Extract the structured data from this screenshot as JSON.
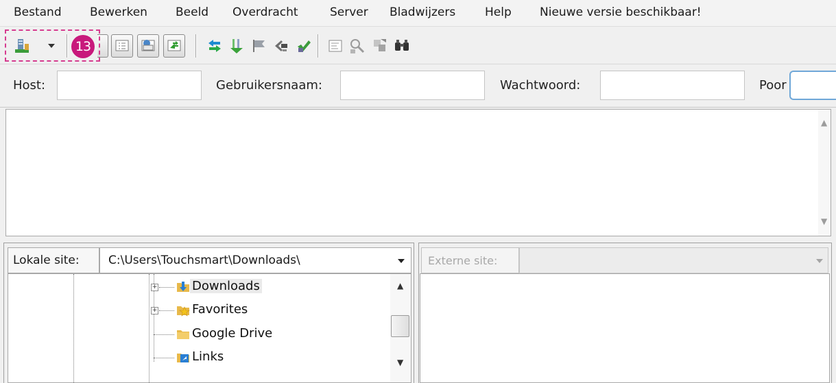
{
  "menu": [
    "Bestand",
    "Bewerken",
    "Beeld",
    "Overdracht",
    "Server",
    "Bladwijzers",
    "Help",
    "Nieuwe versie beschikbaar!"
  ],
  "annotation": {
    "badge_number": "13",
    "color": "#c8197c"
  },
  "toolbar": {
    "icons": [
      "site-manager-icon",
      "dropdown-arrow-icon",
      "toggle-message-log-icon",
      "toggle-local-tree-icon",
      "toggle-remote-tree-icon",
      "toggle-transfer-queue-icon",
      "refresh-icon",
      "process-queue-icon",
      "cancel-icon",
      "disconnect-icon",
      "reconnect-icon",
      "filter-icon",
      "compare-directories-icon",
      "sync-browsing-icon",
      "search-files-icon"
    ]
  },
  "quickconnect": {
    "host_label": "Host:",
    "user_label": "Gebruikersnaam:",
    "password_label": "Wachtwoord:",
    "port_label": "Poor",
    "host_value": "",
    "user_value": "",
    "password_value": ""
  },
  "local": {
    "label": "Lokale site:",
    "path": "C:\\Users\\Touchsmart\\Downloads\\",
    "tree": [
      {
        "label": "Downloads",
        "expandable": true,
        "selected": true,
        "icon": "downloads-folder-icon"
      },
      {
        "label": "Favorites",
        "expandable": true,
        "selected": false,
        "icon": "favorites-folder-icon"
      },
      {
        "label": "Google Drive",
        "expandable": false,
        "selected": false,
        "icon": "folder-icon"
      },
      {
        "label": "Links",
        "expandable": false,
        "selected": false,
        "icon": "links-folder-icon"
      }
    ]
  },
  "remote": {
    "label": "Externe site:",
    "path": ""
  }
}
